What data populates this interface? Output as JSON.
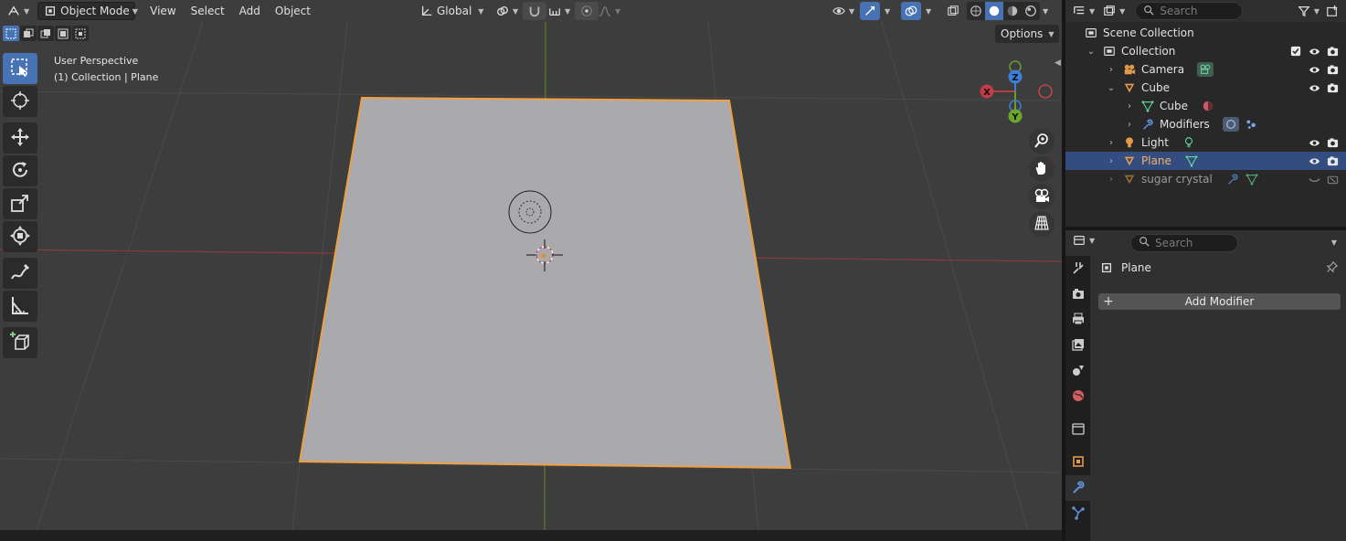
{
  "header": {
    "mode_label": "Object Mode",
    "menus": [
      "View",
      "Select",
      "Add",
      "Object"
    ],
    "orientation_label": "Global"
  },
  "viewport": {
    "info_line1": "User Perspective",
    "info_line2": "(1) Collection | Plane",
    "options_label": "Options",
    "gizmo": {
      "x": "X",
      "y": "Y",
      "z": "Z"
    }
  },
  "outliner": {
    "search_placeholder": "Search",
    "scene_collection": "Scene Collection",
    "rows": [
      {
        "label": "Collection"
      },
      {
        "label": "Camera"
      },
      {
        "label": "Cube"
      },
      {
        "label": "Cube"
      },
      {
        "label": "Modifiers"
      },
      {
        "label": "Light"
      },
      {
        "label": "Plane"
      },
      {
        "label": "sugar crystal"
      }
    ]
  },
  "properties": {
    "search_placeholder": "Search",
    "object_name": "Plane",
    "add_modifier_label": "Add Modifier"
  },
  "colors": {
    "viewport_bg": "#3d3d3d",
    "accent": "#4772b3",
    "selection_outline": "#f5a13a",
    "plane_fill": "#aaaaae",
    "x_axis": "#b34040",
    "y_axis": "#6a9a30",
    "z_axis": "#3b7fd9",
    "outliner_selected": "#334d80"
  }
}
